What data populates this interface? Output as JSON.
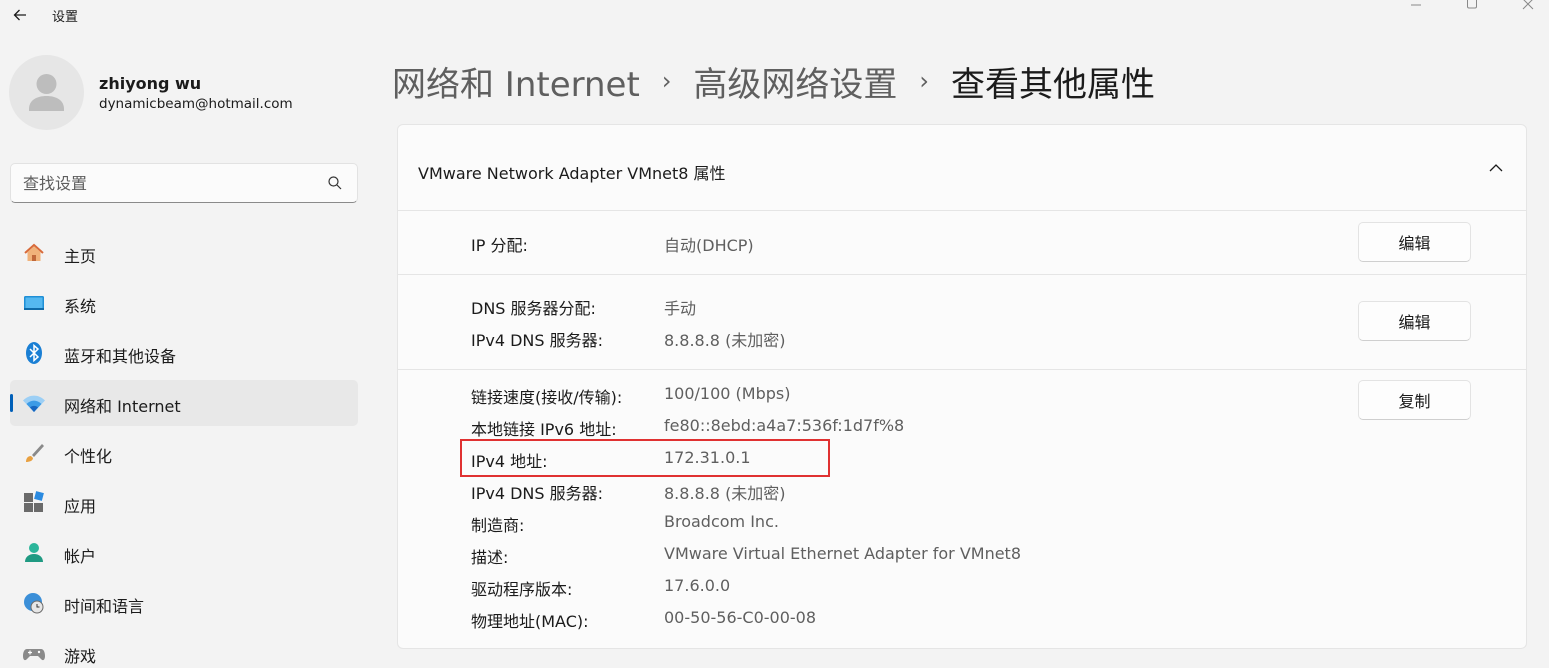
{
  "app": {
    "title": "设置",
    "back_icon": "arrow-left-icon"
  },
  "user": {
    "name": "zhiyong wu",
    "email": "dynamicbeam@hotmail.com"
  },
  "search": {
    "placeholder": "查找设置"
  },
  "sidebar": {
    "items": [
      {
        "label": "主页",
        "icon": "home-icon"
      },
      {
        "label": "系统",
        "icon": "system-monitor-icon"
      },
      {
        "label": "蓝牙和其他设备",
        "icon": "bluetooth-icon"
      },
      {
        "label": "网络和 Internet",
        "icon": "wifi-icon",
        "selected": true
      },
      {
        "label": "个性化",
        "icon": "brush-icon"
      },
      {
        "label": "应用",
        "icon": "apps-icon"
      },
      {
        "label": "帐户",
        "icon": "account-icon"
      },
      {
        "label": "时间和语言",
        "icon": "clock-globe-icon"
      },
      {
        "label": "游戏",
        "icon": "gamepad-icon"
      }
    ]
  },
  "breadcrumb": {
    "items": [
      "网络和 Internet",
      "高级网络设置",
      "查看其他属性"
    ],
    "separator": "›"
  },
  "card": {
    "title": "VMware Network Adapter VMnet8 属性",
    "sections": [
      {
        "rows": [
          {
            "key": "IP 分配:",
            "value": "自动(DHCP)"
          }
        ],
        "button": "编辑"
      },
      {
        "rows": [
          {
            "key": "DNS 服务器分配:",
            "value": "手动"
          },
          {
            "key": "IPv4 DNS 服务器:",
            "value": "8.8.8.8 (未加密)"
          }
        ],
        "button": "编辑"
      },
      {
        "rows": [
          {
            "key": "链接速度(接收/传输):",
            "value": "100/100 (Mbps)"
          },
          {
            "key": "本地链接 IPv6 地址:",
            "value": "fe80::8ebd:a4a7:536f:1d7f%8"
          },
          {
            "key": "IPv4 地址:",
            "value": "172.31.0.1"
          },
          {
            "key": "IPv4 DNS 服务器:",
            "value": "8.8.8.8 (未加密)"
          },
          {
            "key": "制造商:",
            "value": "Broadcom Inc."
          },
          {
            "key": "描述:",
            "value": "VMware Virtual Ethernet Adapter for VMnet8"
          },
          {
            "key": "驱动程序版本:",
            "value": "17.6.0.0"
          },
          {
            "key": "物理地址(MAC):",
            "value": "00-50-56-C0-00-08"
          }
        ],
        "button": "复制"
      }
    ]
  },
  "colors": {
    "accent": "#005fb8",
    "highlight": "#e03131"
  }
}
